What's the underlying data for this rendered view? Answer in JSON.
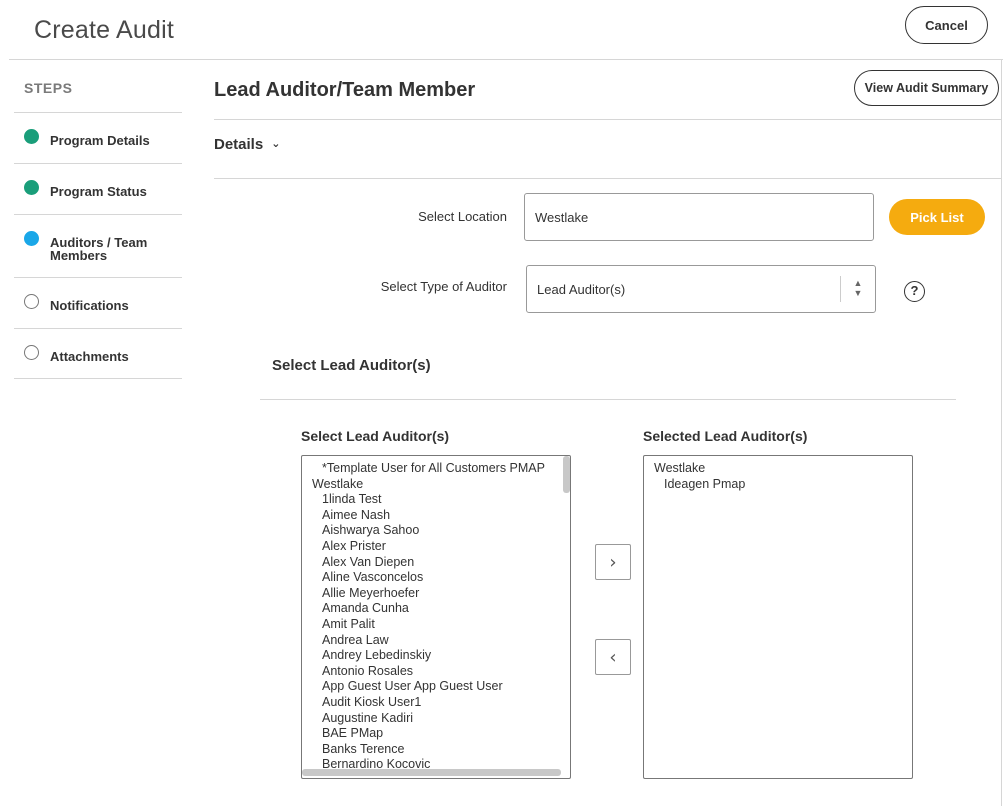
{
  "header": {
    "title": "Create Audit",
    "cancel_label": "Cancel"
  },
  "steps": {
    "title": "STEPS",
    "items": [
      {
        "label": "Program Details",
        "status": "done"
      },
      {
        "label": "Program Status",
        "status": "done"
      },
      {
        "label": "Auditors / Team Members",
        "status": "current"
      },
      {
        "label": "Notifications",
        "status": "todo"
      },
      {
        "label": "Attachments",
        "status": "todo"
      }
    ]
  },
  "main": {
    "section_title": "Lead Auditor/Team Member",
    "summary_label": "View Audit Summary",
    "details_label": "Details",
    "location": {
      "label": "Select Location",
      "value": "Westlake",
      "pick_label": "Pick List"
    },
    "auditor_type": {
      "label": "Select Type of Auditor",
      "value": "Lead Auditor(s)",
      "help": "?"
    },
    "sub_title": "Select Lead Auditor(s)",
    "available": {
      "title": "Select Lead Auditor(s)",
      "items": [
        {
          "text": "*Template User for All Customers PMAP",
          "level": 1
        },
        {
          "text": "Westlake",
          "level": 0
        },
        {
          "text": "1linda Test",
          "level": 1
        },
        {
          "text": "Aimee Nash",
          "level": 1
        },
        {
          "text": "Aishwarya Sahoo",
          "level": 1
        },
        {
          "text": "Alex Prister",
          "level": 1
        },
        {
          "text": "Alex Van Diepen",
          "level": 1
        },
        {
          "text": "Aline Vasconcelos",
          "level": 1
        },
        {
          "text": "Allie Meyerhoefer",
          "level": 1
        },
        {
          "text": "Amanda Cunha",
          "level": 1
        },
        {
          "text": "Amit Palit",
          "level": 1
        },
        {
          "text": "Andrea Law",
          "level": 1
        },
        {
          "text": "Andrey Lebedinskiy",
          "level": 1
        },
        {
          "text": "Antonio Rosales",
          "level": 1
        },
        {
          "text": "App Guest User App Guest User",
          "level": 1
        },
        {
          "text": "Audit Kiosk User1",
          "level": 1
        },
        {
          "text": "Augustine Kadiri",
          "level": 1
        },
        {
          "text": "BAE PMap",
          "level": 1
        },
        {
          "text": "Banks Terence",
          "level": 1
        },
        {
          "text": "Bernardino Kocovic",
          "level": 1
        }
      ]
    },
    "selected": {
      "title": "Selected Lead Auditor(s)",
      "items": [
        {
          "text": "Westlake",
          "level": 0
        },
        {
          "text": "Ideagen Pmap",
          "level": 1
        }
      ]
    },
    "add_icon": "chevron-right-icon",
    "remove_icon": "chevron-left-icon"
  }
}
